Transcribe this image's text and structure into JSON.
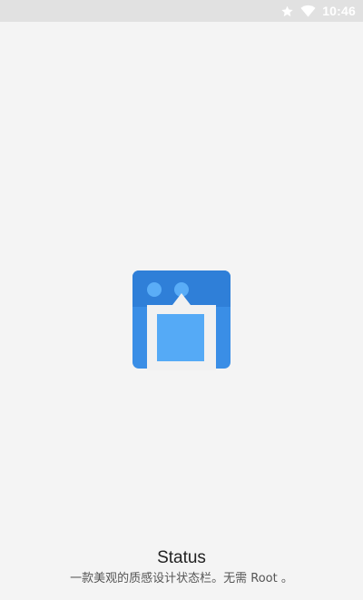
{
  "status_bar": {
    "time": "10:46",
    "icons": [
      "star-icon",
      "wifi-icon"
    ],
    "background": "#e1e1e1"
  },
  "splash": {
    "app_name": "Status",
    "tagline": "一款美观的质感设计状态栏。无需 Root 。",
    "logo_icon": "status-app-logo-icon",
    "colors": {
      "background": "#f4f4f4",
      "logo_blue_dark": "#2f7fd8",
      "logo_blue": "#3a8ee6",
      "logo_blue_light": "#5aadf7"
    }
  }
}
